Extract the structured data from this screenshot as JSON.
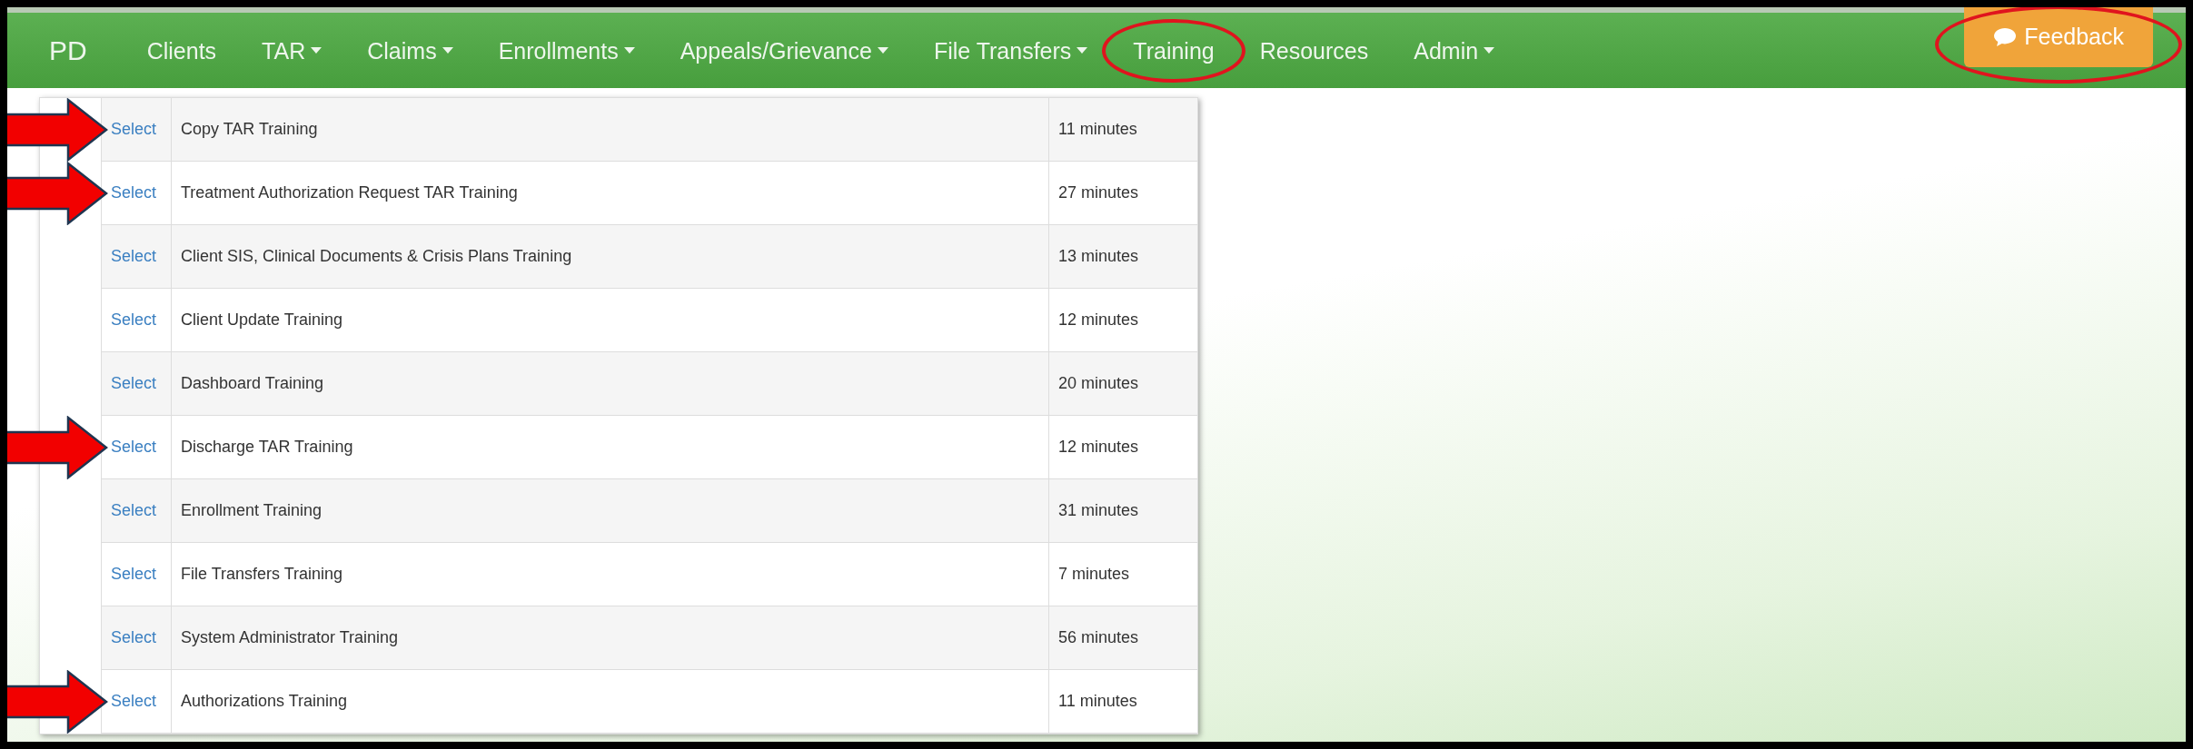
{
  "navbar": {
    "brand": "PD",
    "items": [
      {
        "label": "Clients",
        "dropdown": false,
        "circled": false
      },
      {
        "label": "TAR",
        "dropdown": true,
        "circled": false
      },
      {
        "label": "Claims",
        "dropdown": true,
        "circled": false
      },
      {
        "label": "Enrollments",
        "dropdown": true,
        "circled": false
      },
      {
        "label": "Appeals/Grievance",
        "dropdown": true,
        "circled": false
      },
      {
        "label": "File Transfers",
        "dropdown": true,
        "circled": false
      },
      {
        "label": "Training",
        "dropdown": false,
        "circled": true
      },
      {
        "label": "Resources",
        "dropdown": false,
        "circled": false
      },
      {
        "label": "Admin",
        "dropdown": true,
        "circled": false
      }
    ],
    "feedback_button": {
      "label": "Feedback",
      "circled": true
    }
  },
  "table": {
    "rows": [
      {
        "action": "Select",
        "name": "Copy TAR Training",
        "duration": "11 minutes",
        "arrow": true
      },
      {
        "action": "Select",
        "name": "Treatment Authorization Request TAR Training",
        "duration": "27 minutes",
        "arrow": true
      },
      {
        "action": "Select",
        "name": "Client SIS, Clinical Documents & Crisis Plans Training",
        "duration": "13 minutes",
        "arrow": false
      },
      {
        "action": "Select",
        "name": "Client Update Training",
        "duration": "12 minutes",
        "arrow": false
      },
      {
        "action": "Select",
        "name": "Dashboard Training",
        "duration": "20 minutes",
        "arrow": false
      },
      {
        "action": "Select",
        "name": "Discharge TAR Training",
        "duration": "12 minutes",
        "arrow": true
      },
      {
        "action": "Select",
        "name": "Enrollment Training",
        "duration": "31 minutes",
        "arrow": false
      },
      {
        "action": "Select",
        "name": "File Transfers Training",
        "duration": "7 minutes",
        "arrow": false
      },
      {
        "action": "Select",
        "name": "System Administrator Training",
        "duration": "56 minutes",
        "arrow": false
      },
      {
        "action": "Select",
        "name": "Authorizations Training",
        "duration": "11 minutes",
        "arrow": true
      }
    ]
  }
}
